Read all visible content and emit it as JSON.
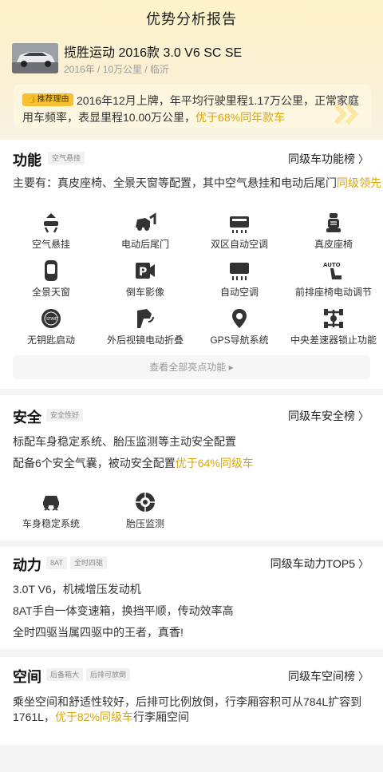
{
  "header": {
    "title": "优势分析报告"
  },
  "car": {
    "name": "揽胜运动 2016款 3.0 V6 SC SE",
    "meta": "2016年 / 10万公里 / 临沂"
  },
  "reason": {
    "badge": "推荐理由",
    "text_plain": "2016年12月上牌，年平均行驶里程1.17万公里，正常家庭用车频率，表显里程10.00万公里，",
    "text_highlight": "优于68%同年款车"
  },
  "features": {
    "title": "功能",
    "tag": "空气悬挂",
    "rank_link": "同级车功能榜",
    "desc_plain": "主要有：真皮座椅、全景天窗等配置，其中空气悬挂和电动后尾门",
    "desc_highlight": "同级领先",
    "items": [
      {
        "label": "空气悬挂",
        "icon": "air-suspension-icon"
      },
      {
        "label": "电动后尾门",
        "icon": "power-tailgate-icon"
      },
      {
        "label": "双区自动空调",
        "icon": "dual-zone-ac-icon"
      },
      {
        "label": "真皮座椅",
        "icon": "leather-seat-icon"
      },
      {
        "label": "全景天窗",
        "icon": "panoramic-sunroof-icon"
      },
      {
        "label": "倒车影像",
        "icon": "rear-camera-icon"
      },
      {
        "label": "自动空调",
        "icon": "auto-ac-icon"
      },
      {
        "label": "前排座椅电动调节",
        "icon": "power-seat-icon"
      },
      {
        "label": "无钥匙启动",
        "icon": "keyless-start-icon"
      },
      {
        "label": "外后视镜电动折叠",
        "icon": "mirror-fold-icon"
      },
      {
        "label": "GPS导航系统",
        "icon": "gps-nav-icon"
      },
      {
        "label": "中央差速器锁止功能",
        "icon": "diff-lock-icon"
      }
    ],
    "see_all": "查看全部亮点功能"
  },
  "safety": {
    "title": "安全",
    "tag": "安全性好",
    "rank_link": "同级车安全榜",
    "line1": "标配车身稳定系统、胎压监测等主动安全配置",
    "line2_plain": "配备6个安全气囊，被动安全配置",
    "line2_highlight": "优于64%同级车",
    "items": [
      {
        "label": "车身稳定系统",
        "icon": "stability-control-icon"
      },
      {
        "label": "胎压监测",
        "icon": "tire-pressure-icon"
      }
    ]
  },
  "power": {
    "title": "动力",
    "tags": [
      "8AT",
      "全时四驱"
    ],
    "rank_link": "同级车动力TOP5",
    "lines": [
      "3.0T V6，机械增压发动机",
      "8AT手自一体变速箱，换挡平顺，传动效率高",
      "全时四驱当属四驱中的王者，真香!"
    ]
  },
  "space": {
    "title": "空间",
    "tags": [
      "后备箱大",
      "后排可放倒"
    ],
    "rank_link": "同级车空间榜",
    "line1": "乘坐空间和舒适性较好，后排可比例放倒，行李厢容积可从784L扩容到",
    "line2_pre": "1761L，",
    "line2_highlight": "优于82%同级车",
    "line2_post": "行李厢空间"
  },
  "colors": {
    "accent": "#f5c133",
    "highlight": "#d8a60e"
  }
}
